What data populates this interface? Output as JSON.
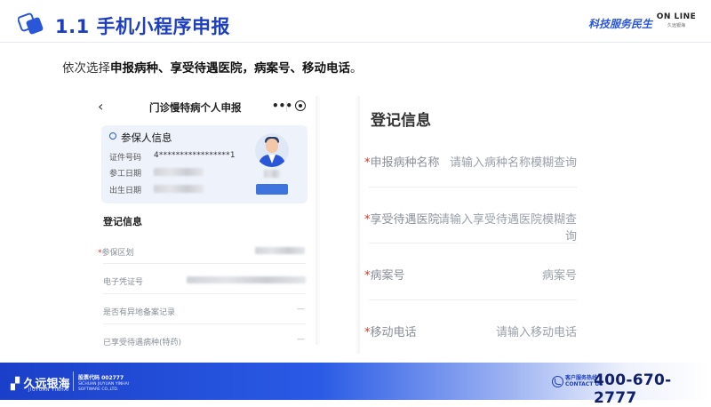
{
  "header": {
    "title": "1.1 手机小程序申报",
    "brand_slogan": "科技服务民生",
    "online_logo": "ON LINE",
    "online_logo_sub": "久远银海"
  },
  "instruction": {
    "prefix": "依次选择",
    "emphasis": "申报病种、享受待遇医院，病案号、移动电话",
    "suffix": "。"
  },
  "phone": {
    "nav": {
      "back_icon": "chevron-left-icon",
      "title": "门诊慢特病个人申报",
      "more_icon": "more-dots-icon",
      "close_icon": "target-close-icon"
    },
    "insured_card": {
      "title": "参保人信息",
      "rows": [
        {
          "label": "证件号码",
          "value": "4*****************1"
        },
        {
          "label": "参工日期",
          "value": ""
        },
        {
          "label": "出生日期",
          "value": ""
        }
      ]
    },
    "registration": {
      "title": "登记信息",
      "fields": [
        {
          "label": "参保区划",
          "required": true
        },
        {
          "label": "电子凭证号",
          "required": false
        },
        {
          "label": "是否有异地备案记录",
          "required": false,
          "value": "—"
        },
        {
          "label": "已享受待遇病种(特药)",
          "required": false,
          "value": "—"
        }
      ]
    }
  },
  "zoom_panel": {
    "title": "登记信息",
    "fields": [
      {
        "label": "申报病种名称",
        "required": true,
        "placeholder": "请输入病种名称模糊查询"
      },
      {
        "label": "享受待遇医院",
        "required": true,
        "placeholder": "请输入享受待遇医院模糊查询"
      },
      {
        "label": "病案号",
        "required": true,
        "placeholder": "病案号"
      },
      {
        "label": "移动电话",
        "required": true,
        "placeholder": "请输入移动电话"
      }
    ]
  },
  "footer": {
    "logo": "久远银海",
    "logo_sub": "JIUYUAN YINHAI",
    "stock_code": "股票代码 002777",
    "company_en": "SICHUAN JIUYUAN YINHAI SOFTWARE CO.,LTD.",
    "hotline_label_cn": "客户服务热线",
    "hotline_label_en": "CONTACT US",
    "hotline_number": "400-670-2777"
  },
  "colors": {
    "accent": "#1d3fbf",
    "required": "#e03030",
    "card_bg": "#eef3fb"
  }
}
